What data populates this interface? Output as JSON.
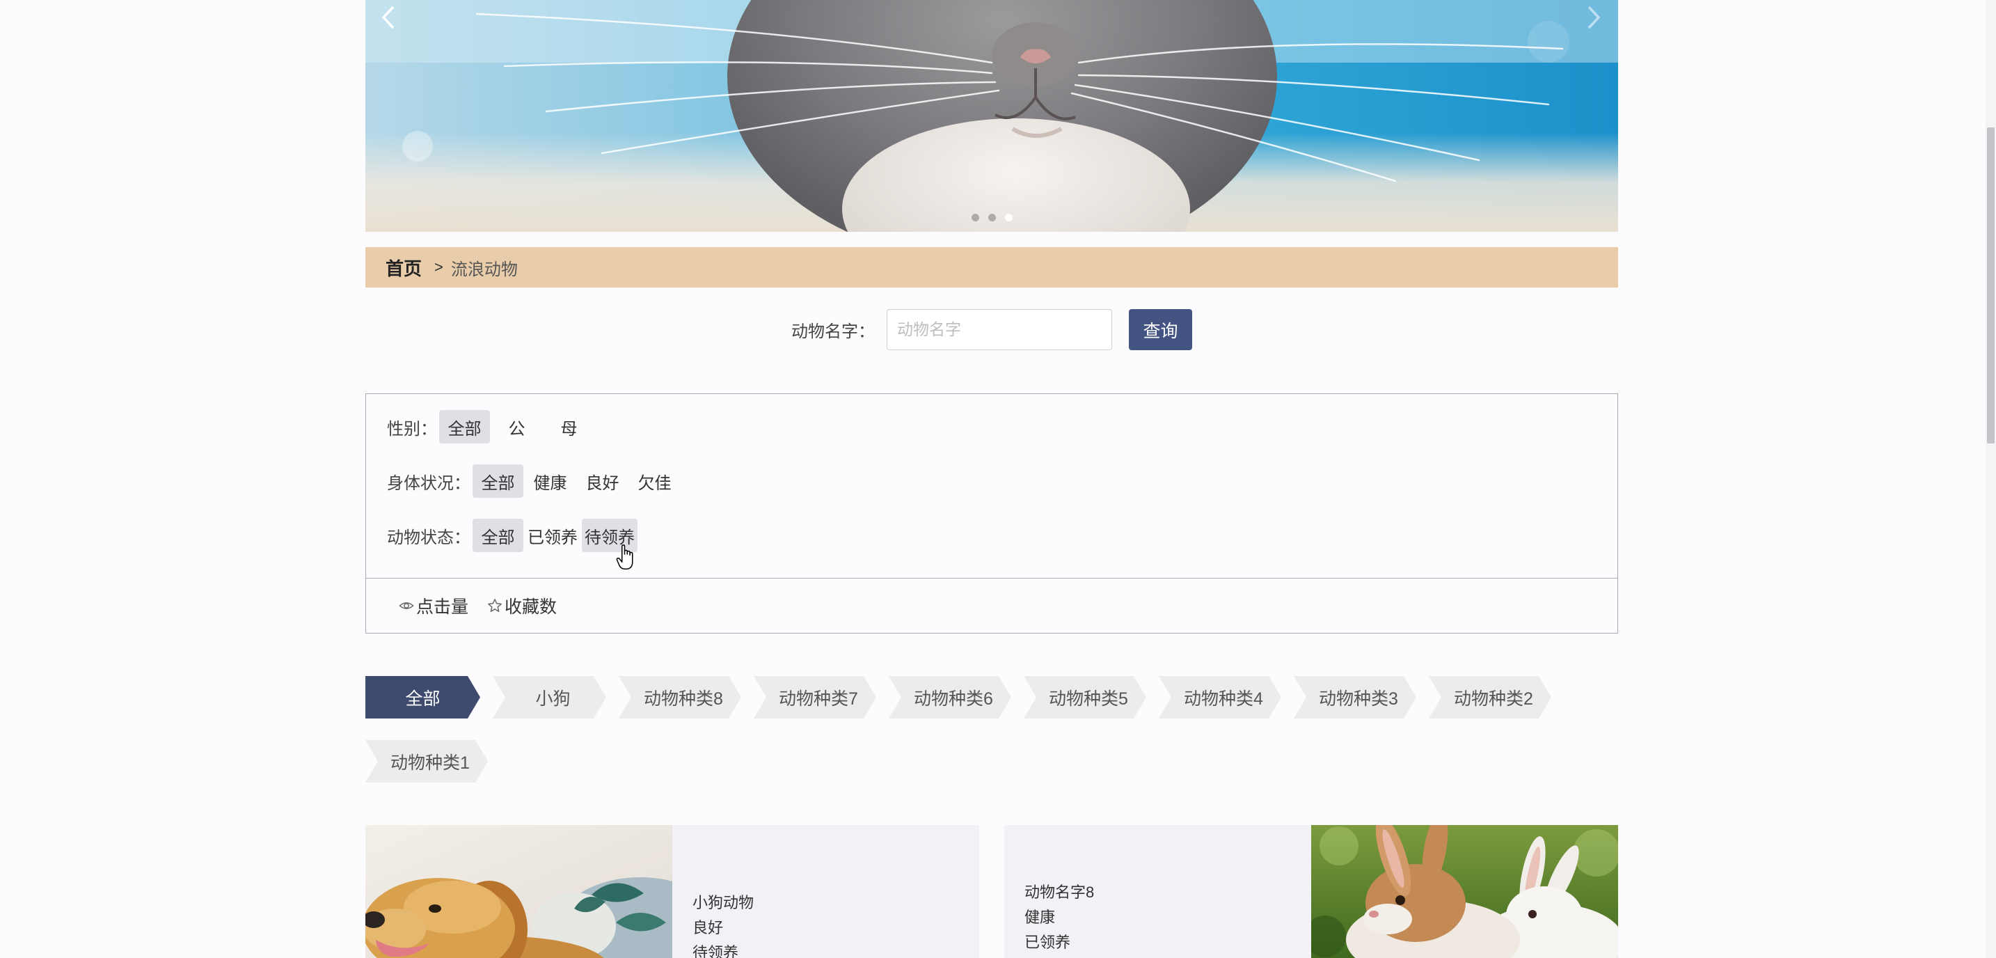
{
  "carousel": {
    "prev_icon": "chevron-left-icon",
    "next_icon": "chevron-right-icon",
    "slide_count": 3,
    "active_slide": 3
  },
  "breadcrumb": {
    "home": "首页",
    "separator": ">",
    "current": "流浪动物"
  },
  "search": {
    "label": "动物名字：",
    "placeholder": "动物名字",
    "value": "",
    "button_label": "查询"
  },
  "filters": [
    {
      "label": "性别：",
      "options": [
        {
          "label": "全部",
          "selected": true
        },
        {
          "label": "公",
          "selected": false
        },
        {
          "label": "母",
          "selected": false
        }
      ]
    },
    {
      "label": "身体状况：",
      "options": [
        {
          "label": "全部",
          "selected": true
        },
        {
          "label": "健康",
          "selected": false
        },
        {
          "label": "良好",
          "selected": false
        },
        {
          "label": "欠佳",
          "selected": false
        }
      ]
    },
    {
      "label": "动物状态：",
      "options": [
        {
          "label": "全部",
          "selected": true
        },
        {
          "label": "已领养",
          "selected": false
        },
        {
          "label": "待领养",
          "selected": false,
          "hovered": true
        }
      ]
    }
  ],
  "sort": [
    {
      "label": "点击量",
      "icon": "eye-icon"
    },
    {
      "label": "收藏数",
      "icon": "star-icon"
    }
  ],
  "categories": {
    "items": [
      "全部",
      "小狗",
      "动物种类8",
      "动物种类7",
      "动物种类6",
      "动物种类5",
      "动物种类4",
      "动物种类3",
      "动物种类2",
      "动物种类1"
    ],
    "active": "全部"
  },
  "animals": [
    {
      "name": "小狗动物",
      "health": "良好",
      "status": "待领养"
    },
    {
      "name": "动物名字8",
      "health": "健康",
      "status": "已领养"
    }
  ],
  "colors": {
    "page_bg": "#fcfbfe",
    "breadcrumb_bg": "#e9cdaa",
    "button_bg": "#445482",
    "pill_bg": "#dfdfe6",
    "category_bg": "#ececee",
    "category_active_bg": "#3f4b6e",
    "card_panel_bg": "#f1f1f6"
  }
}
